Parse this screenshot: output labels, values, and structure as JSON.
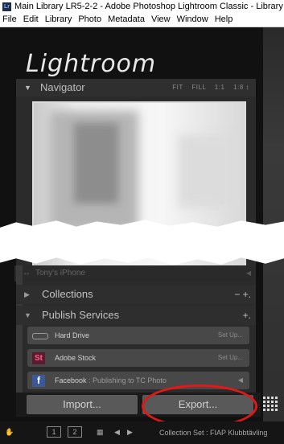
{
  "window": {
    "app_icon": "Lr",
    "title": "Main Library LR5-2-2 - Adobe Photoshop Lightroom Classic - Library"
  },
  "menu": [
    "File",
    "Edit",
    "Library",
    "Photo",
    "Metadata",
    "View",
    "Window",
    "Help"
  ],
  "logo": "Lightroom",
  "navigator": {
    "label": "Navigator",
    "zoom_options": [
      "FIT",
      "FILL",
      "1:1",
      "1:8 ↕"
    ]
  },
  "partial_row": {
    "label": "Tony's iPhone"
  },
  "collections": {
    "label": "Collections",
    "controls": "− +."
  },
  "publish_services": {
    "label": "Publish Services",
    "add": "+.",
    "services": [
      {
        "icon": "hard-drive-icon",
        "name": "Hard Drive",
        "action": "Set Up..."
      },
      {
        "icon": "adobe-stock-icon",
        "badge": "St",
        "name": "Adobe Stock",
        "action": "Set Up..."
      },
      {
        "icon": "facebook-icon",
        "badge": "f",
        "name": "Facebook",
        "subtitle": ": Publishing to TC Photo",
        "action": "◀"
      }
    ]
  },
  "buttons": {
    "import": "Import...",
    "export": "Export..."
  },
  "filmstrip": {
    "page1": "1",
    "page2": "2",
    "source": "Collection Set : FIAP Klubbtävling"
  },
  "colors": {
    "highlight_ring": "#e01818",
    "panel": "#2b2b2b"
  }
}
